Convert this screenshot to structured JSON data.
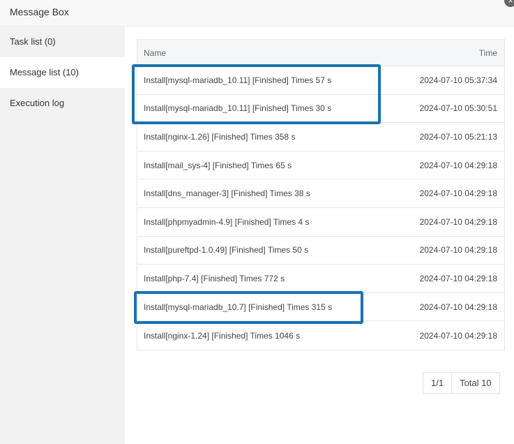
{
  "window": {
    "title": "Message Box",
    "close_symbol": "×"
  },
  "sidebar": {
    "items": [
      {
        "label": "Task list (0)"
      },
      {
        "label": "Message list (10)"
      },
      {
        "label": "Execution log"
      }
    ],
    "active_index": 1
  },
  "table": {
    "columns": {
      "name": "Name",
      "time": "Time"
    },
    "rows": [
      {
        "name": "Install[mysql-mariadb_10.11] [Finished] Times 57 s",
        "time": "2024-07-10 05:37:34"
      },
      {
        "name": "Install[mysql-mariadb_10.11] [Finished] Times 30 s",
        "time": "2024-07-10 05:30:51"
      },
      {
        "name": "Install[nginx-1.26] [Finished] Times 358 s",
        "time": "2024-07-10 05:21:13"
      },
      {
        "name": "Install[mail_sys-4] [Finished] Times 65 s",
        "time": "2024-07-10 04:29:18"
      },
      {
        "name": "Install[dns_manager-3] [Finished] Times 38 s",
        "time": "2024-07-10 04:29:18"
      },
      {
        "name": "Install[phpmyadmin-4.9] [Finished] Times 4 s",
        "time": "2024-07-10 04:29:18"
      },
      {
        "name": "Install[pureftpd-1.0.49] [Finished] Times 50 s",
        "time": "2024-07-10 04:29:18"
      },
      {
        "name": "Install[php-7.4] [Finished] Times 772 s",
        "time": "2024-07-10 04:29:18"
      },
      {
        "name": "Install[mysql-mariadb_10.7] [Finished] Times 315 s",
        "time": "2024-07-10 04:29:18"
      },
      {
        "name": "Install[nginx-1.24] [Finished] Times 1046 s",
        "time": "2024-07-10 04:29:18"
      }
    ]
  },
  "pagination": {
    "page": "1/1",
    "total": "Total 10"
  },
  "colors": {
    "highlight": "#1a72b3",
    "sidebar_bg": "#f2f2f2",
    "header_bg": "#f5f6f7"
  }
}
